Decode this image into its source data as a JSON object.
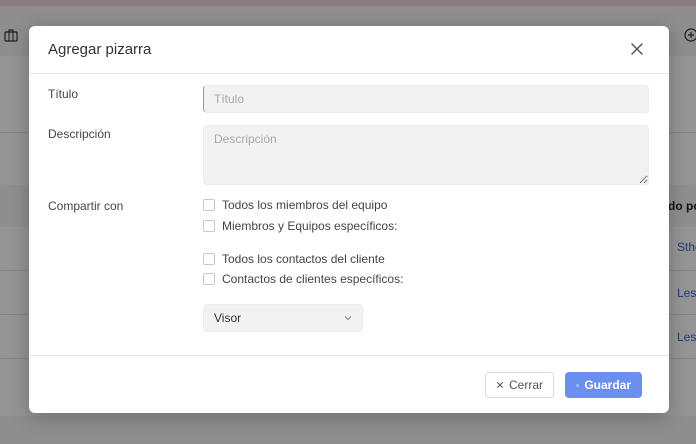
{
  "background": {
    "column_header_partial": "do po",
    "row_values": [
      "Sthe",
      "Les",
      "Les"
    ]
  },
  "modal": {
    "title": "Agregar pizarra",
    "fields": {
      "title_label": "Título",
      "title_placeholder": "Título",
      "description_label": "Descripción",
      "description_placeholder": "Descripción",
      "share_label": "Compartir con"
    },
    "share_options": {
      "all_team_members": "Todos los miembros del equipo",
      "specific_members_teams": "Miembros y Equipos específicos:",
      "all_client_contacts": "Todos los contactos del cliente",
      "specific_client_contacts": "Contactos de clientes específicos:"
    },
    "permission_select": {
      "value": "Visor"
    },
    "footer": {
      "close_label": "Cerrar",
      "save_label": "Guardar"
    }
  },
  "colors": {
    "primary": "#6b8ff0",
    "overlay": "rgba(0,0,0,0.42)"
  }
}
